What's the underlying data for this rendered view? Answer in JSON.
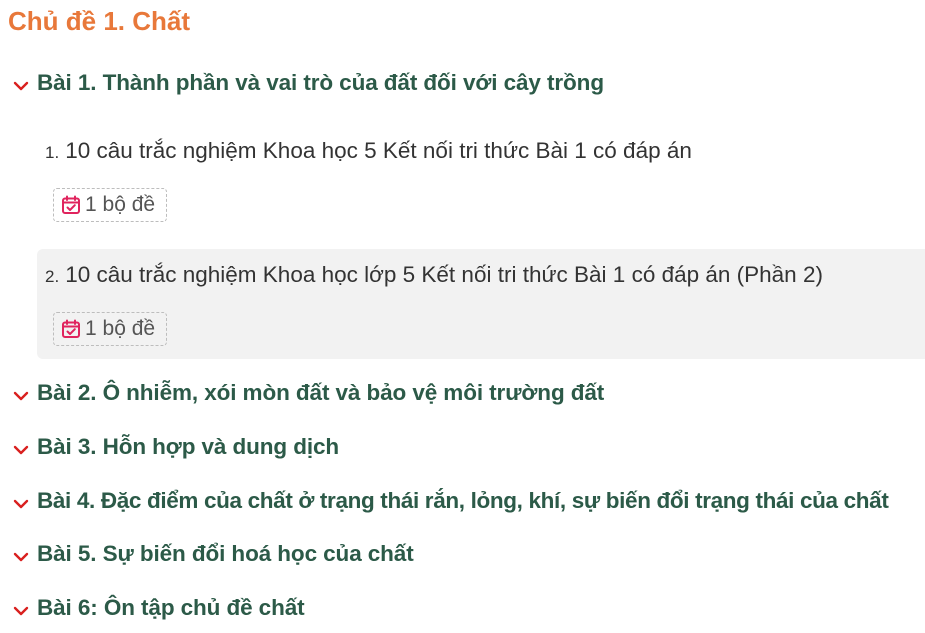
{
  "topic_title": "Chủ đề 1. Chất",
  "lessons": [
    {
      "label": "Bài 1. Thành phần và vai trò của đất đối với cây trồng"
    },
    {
      "label": "Bài 2. Ô nhiễm, xói mòn đất và bảo vệ môi trường đất"
    },
    {
      "label": "Bài 3. Hỗn hợp và dung dịch"
    },
    {
      "label": "Bài 4. Đặc điểm của chất ở trạng thái rắn, lỏng, khí, sự biến đổi trạng thái của chất"
    },
    {
      "label": "Bài 5. Sự biến đổi hoá học của chất"
    },
    {
      "label": "Bài 6: Ôn tập chủ đề chất"
    }
  ],
  "quizzes": [
    {
      "number": "1.",
      "title": "10 câu trắc nghiệm Khoa học 5 Kết nối tri thức Bài 1 có đáp án",
      "badge": "1 bộ đề"
    },
    {
      "number": "2.",
      "title": "10 câu trắc nghiệm Khoa học lớp 5 Kết nối tri thức Bài 1 có đáp án (Phần 2)",
      "badge": "1 bộ đề"
    }
  ],
  "colors": {
    "topic_title": "#e8783a",
    "lesson_label": "#2c5a48",
    "chevron": "#d9201f",
    "calendar_icon": "#e0245e",
    "highlight_bg": "#f2f2f2"
  },
  "icons": {
    "lesson_toggle": "chevron-down-icon",
    "badge": "calendar-check-icon"
  }
}
